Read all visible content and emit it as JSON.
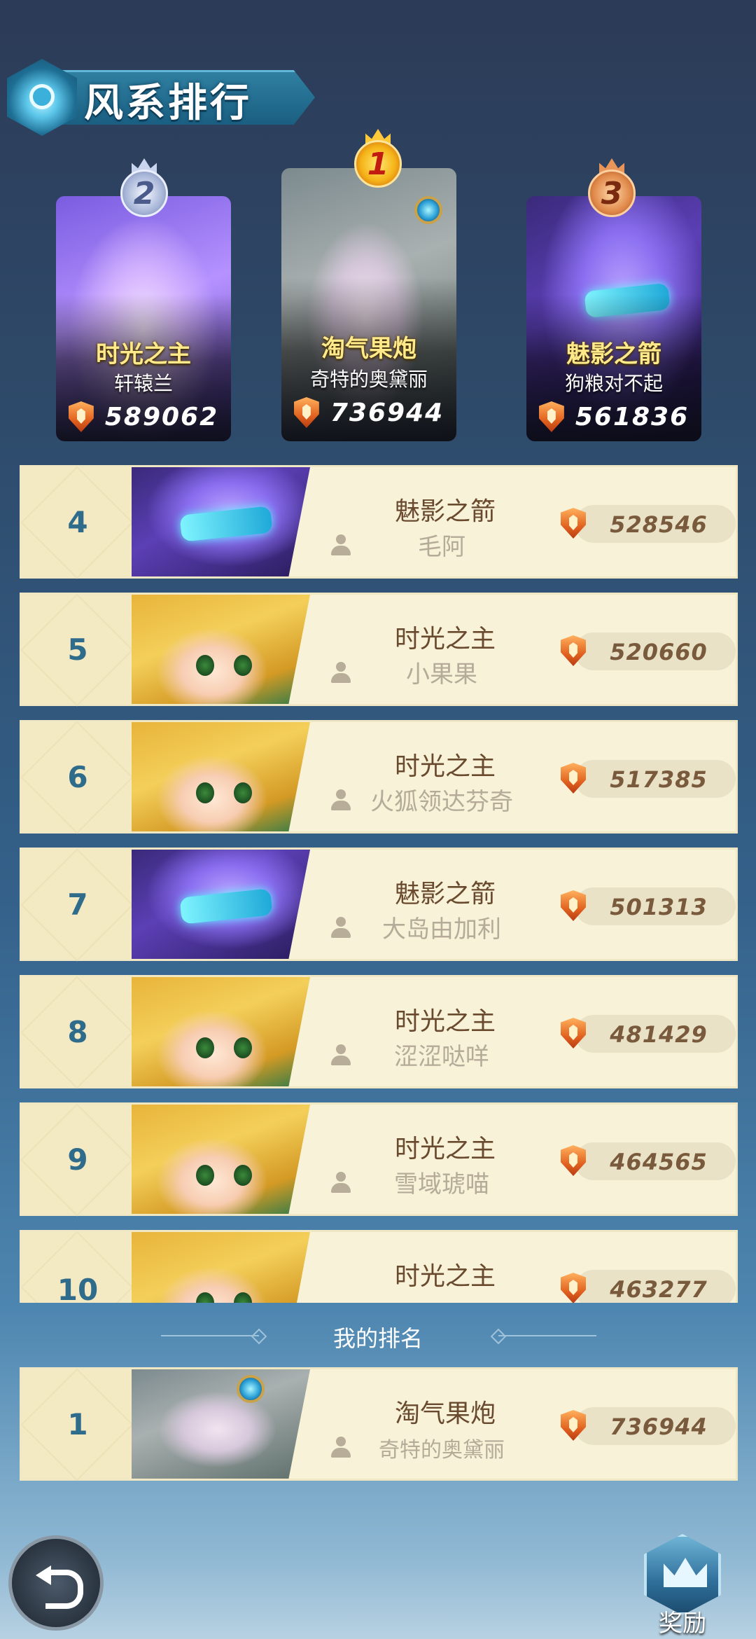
{
  "header": {
    "title": "风系排行"
  },
  "podium": [
    {
      "rank": "2",
      "hero": "时光之主",
      "player": "轩辕兰",
      "score": "589062"
    },
    {
      "rank": "1",
      "hero": "淘气果炮",
      "player": "奇特的奥黛丽",
      "score": "736944"
    },
    {
      "rank": "3",
      "hero": "魅影之箭",
      "player": "狗粮对不起",
      "score": "561836"
    }
  ],
  "rows": [
    {
      "rank": "4",
      "hero": "魅影之箭",
      "player": "毛阿",
      "score": "528546"
    },
    {
      "rank": "5",
      "hero": "时光之主",
      "player": "小果果",
      "score": "520660"
    },
    {
      "rank": "6",
      "hero": "时光之主",
      "player": "火狐领达芬奇",
      "score": "517385"
    },
    {
      "rank": "7",
      "hero": "魅影之箭",
      "player": "大岛由加利",
      "score": "501313"
    },
    {
      "rank": "8",
      "hero": "时光之主",
      "player": "涩涩哒咩",
      "score": "481429"
    },
    {
      "rank": "9",
      "hero": "时光之主",
      "player": "雪域琥喵",
      "score": "464565"
    },
    {
      "rank": "10",
      "hero": "时光之主",
      "player": "",
      "score": "463277"
    }
  ],
  "my_rank": {
    "label": "我的排名",
    "rank": "1",
    "hero": "淘气果炮",
    "player": "奇特的奥黛丽",
    "score": "736944"
  },
  "footer": {
    "reward_label": "奖励"
  },
  "icons": {
    "title": "wind-emblem-icon",
    "score": "shield-icon",
    "player": "user-icon",
    "back": "back-arrow-icon",
    "reward": "reward-crown-icon"
  },
  "colors": {
    "rank_number": "#2f6c8c",
    "hero_name_highlight": "#ffe98a",
    "row_background": "#f7f2d8"
  }
}
